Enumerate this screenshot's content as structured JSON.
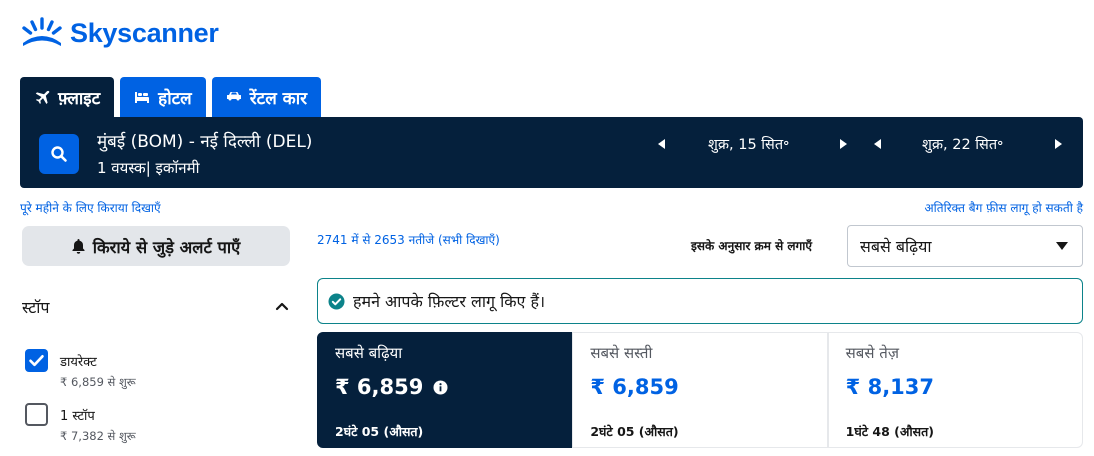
{
  "brand": {
    "name": "Skyscanner",
    "color": "#0062e3"
  },
  "tabs": [
    {
      "label": "फ़्लाइट",
      "icon": "plane-icon",
      "active": true
    },
    {
      "label": "होटल",
      "icon": "bed-icon",
      "active": false
    },
    {
      "label": "रेंटल कार",
      "icon": "car-icon",
      "active": false
    }
  ],
  "search": {
    "route": "मुंबई (BOM) - नई दिल्ली (DEL)",
    "passengers": "1 वयस्क| इकॉनमी",
    "depart_date": "शुक्र, 15 सित॰",
    "return_date": "शुक्र, 22 सित॰"
  },
  "links": {
    "month_fares": "पूरे महीने के लिए किराया दिखाएँ",
    "baggage_fees": "अतिरिक्त बैग फ़ीस लागू हो सकती है"
  },
  "sidebar": {
    "alert_button": "किराये से जुड़े अलर्ट पाएँ",
    "stops_heading": "स्टॉप",
    "stops": [
      {
        "label": "डायरेक्ट",
        "price": "₹ 6,859 से शुरू",
        "checked": true
      },
      {
        "label": "1 स्टॉप",
        "price": "₹ 7,382 से शुरू",
        "checked": false
      }
    ]
  },
  "results": {
    "count_text": "2741 में से 2653 नतीजे (सभी दिखाएँ)",
    "sort_label": "इसके अनुसार क्रम से लगाएँ",
    "sort_value": "सबसे बढ़िया",
    "notice": "हमने आपके फ़िल्टर लागू किए हैं।",
    "cards": [
      {
        "label": "सबसे बढ़िया",
        "price": "₹ 6,859",
        "duration": "2घंटे 05 (औसत)",
        "active": true
      },
      {
        "label": "सबसे सस्ती",
        "price": "₹ 6,859",
        "duration": "2घंटे 05 (औसत)",
        "active": false
      },
      {
        "label": "सबसे तेज़",
        "price": "₹ 8,137",
        "duration": "1घंटे 48 (औसत)",
        "active": false
      }
    ]
  }
}
